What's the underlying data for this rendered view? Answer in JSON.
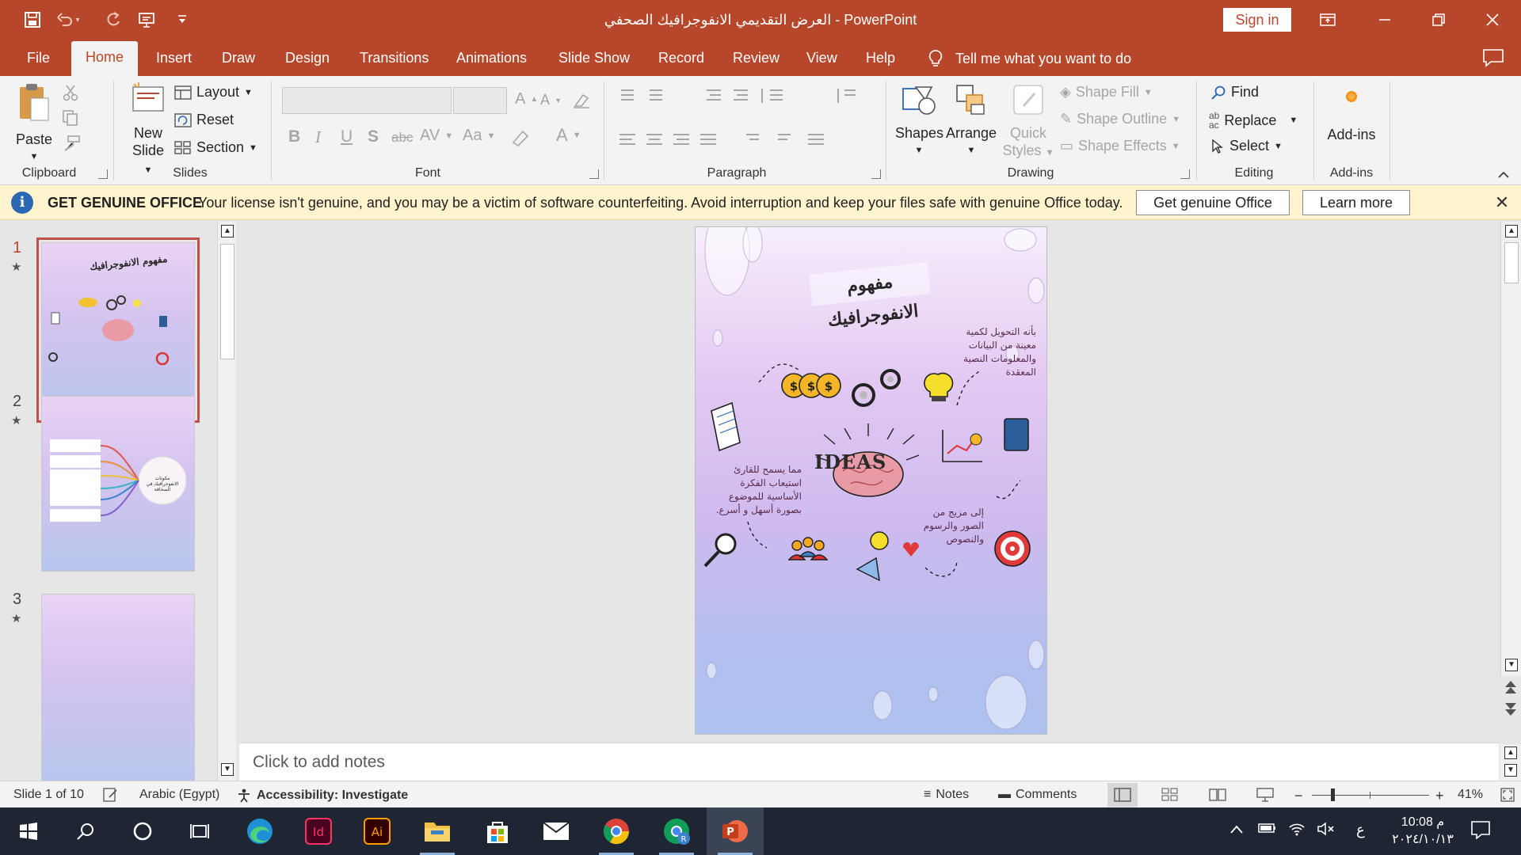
{
  "titlebar": {
    "document_title": "العرض التقديمي الانفوجرافيك الصحفي",
    "separator": " - ",
    "app_name": "PowerPoint",
    "signin_label": "Sign in"
  },
  "tabs": [
    "File",
    "Home",
    "Insert",
    "Draw",
    "Design",
    "Transitions",
    "Animations",
    "Slide Show",
    "Record",
    "Review",
    "View",
    "Help"
  ],
  "tell_me": "Tell me what you want to do",
  "ribbon": {
    "clipboard": {
      "paste": "Paste",
      "label": "Clipboard"
    },
    "slides": {
      "new_slide_line1": "New",
      "new_slide_line2": "Slide",
      "layout": "Layout",
      "reset": "Reset",
      "section": "Section",
      "label": "Slides"
    },
    "font": {
      "label": "Font",
      "bold": "B",
      "italic": "I",
      "underline": "U",
      "shadow": "S",
      "strike": "abc",
      "spacing": "AV",
      "case": "Aa",
      "color": "A"
    },
    "paragraph": {
      "label": "Paragraph"
    },
    "drawing": {
      "shapes": "Shapes",
      "arrange": "Arrange",
      "quick_styles_line1": "Quick",
      "quick_styles_line2": "Styles",
      "shape_fill": "Shape Fill",
      "shape_outline": "Shape Outline",
      "shape_effects": "Shape Effects",
      "label": "Drawing"
    },
    "editing": {
      "find": "Find",
      "replace": "Replace",
      "select": "Select",
      "label": "Editing"
    },
    "addins": {
      "button": "Add-ins",
      "label": "Add-ins"
    }
  },
  "message_bar": {
    "title": "GET GENUINE OFFICE",
    "text": "Your license isn't genuine, and you may be a victim of software counterfeiting. Avoid interruption and keep your files safe with genuine Office today.",
    "btn_primary": "Get genuine Office",
    "btn_secondary": "Learn more"
  },
  "thumbnails": [
    {
      "num": "1",
      "star": "★",
      "title": "مفهوم الانفوجرافيك"
    },
    {
      "num": "2",
      "star": "★",
      "title": "مكونات الانفوجرافيك في الصحافة"
    },
    {
      "num": "3",
      "star": "★"
    }
  ],
  "slide": {
    "title": "مفهوم الانفوجرافيك",
    "text_top_right": "بأنه التحويل لكمية معينة من البيانات والمعلومات النصية المعقدة",
    "text_left": "مما يسمح للقارئ استيعاب الفكرة الأساسية للموضوع بصورة أسهل و أسرع.",
    "text_bottom_right": "إلى مزيج من الصور والرسوم والنصوص",
    "ideas_label": "IDEAS"
  },
  "notes_placeholder": "Click to add notes",
  "status": {
    "slide_info": "Slide 1 of 10",
    "language": "Arabic (Egypt)",
    "accessibility": "Accessibility: Investigate",
    "notes": "Notes",
    "comments": "Comments",
    "zoom": "41%"
  },
  "taskbar": {
    "time": "10:08 م",
    "date": "٢٠٢٤/١٠/١٣",
    "lang": "ع"
  },
  "colors": {
    "accent": "#b7472a",
    "message_bar_bg": "#fff4ce",
    "taskbar_bg": "#1f2633"
  }
}
